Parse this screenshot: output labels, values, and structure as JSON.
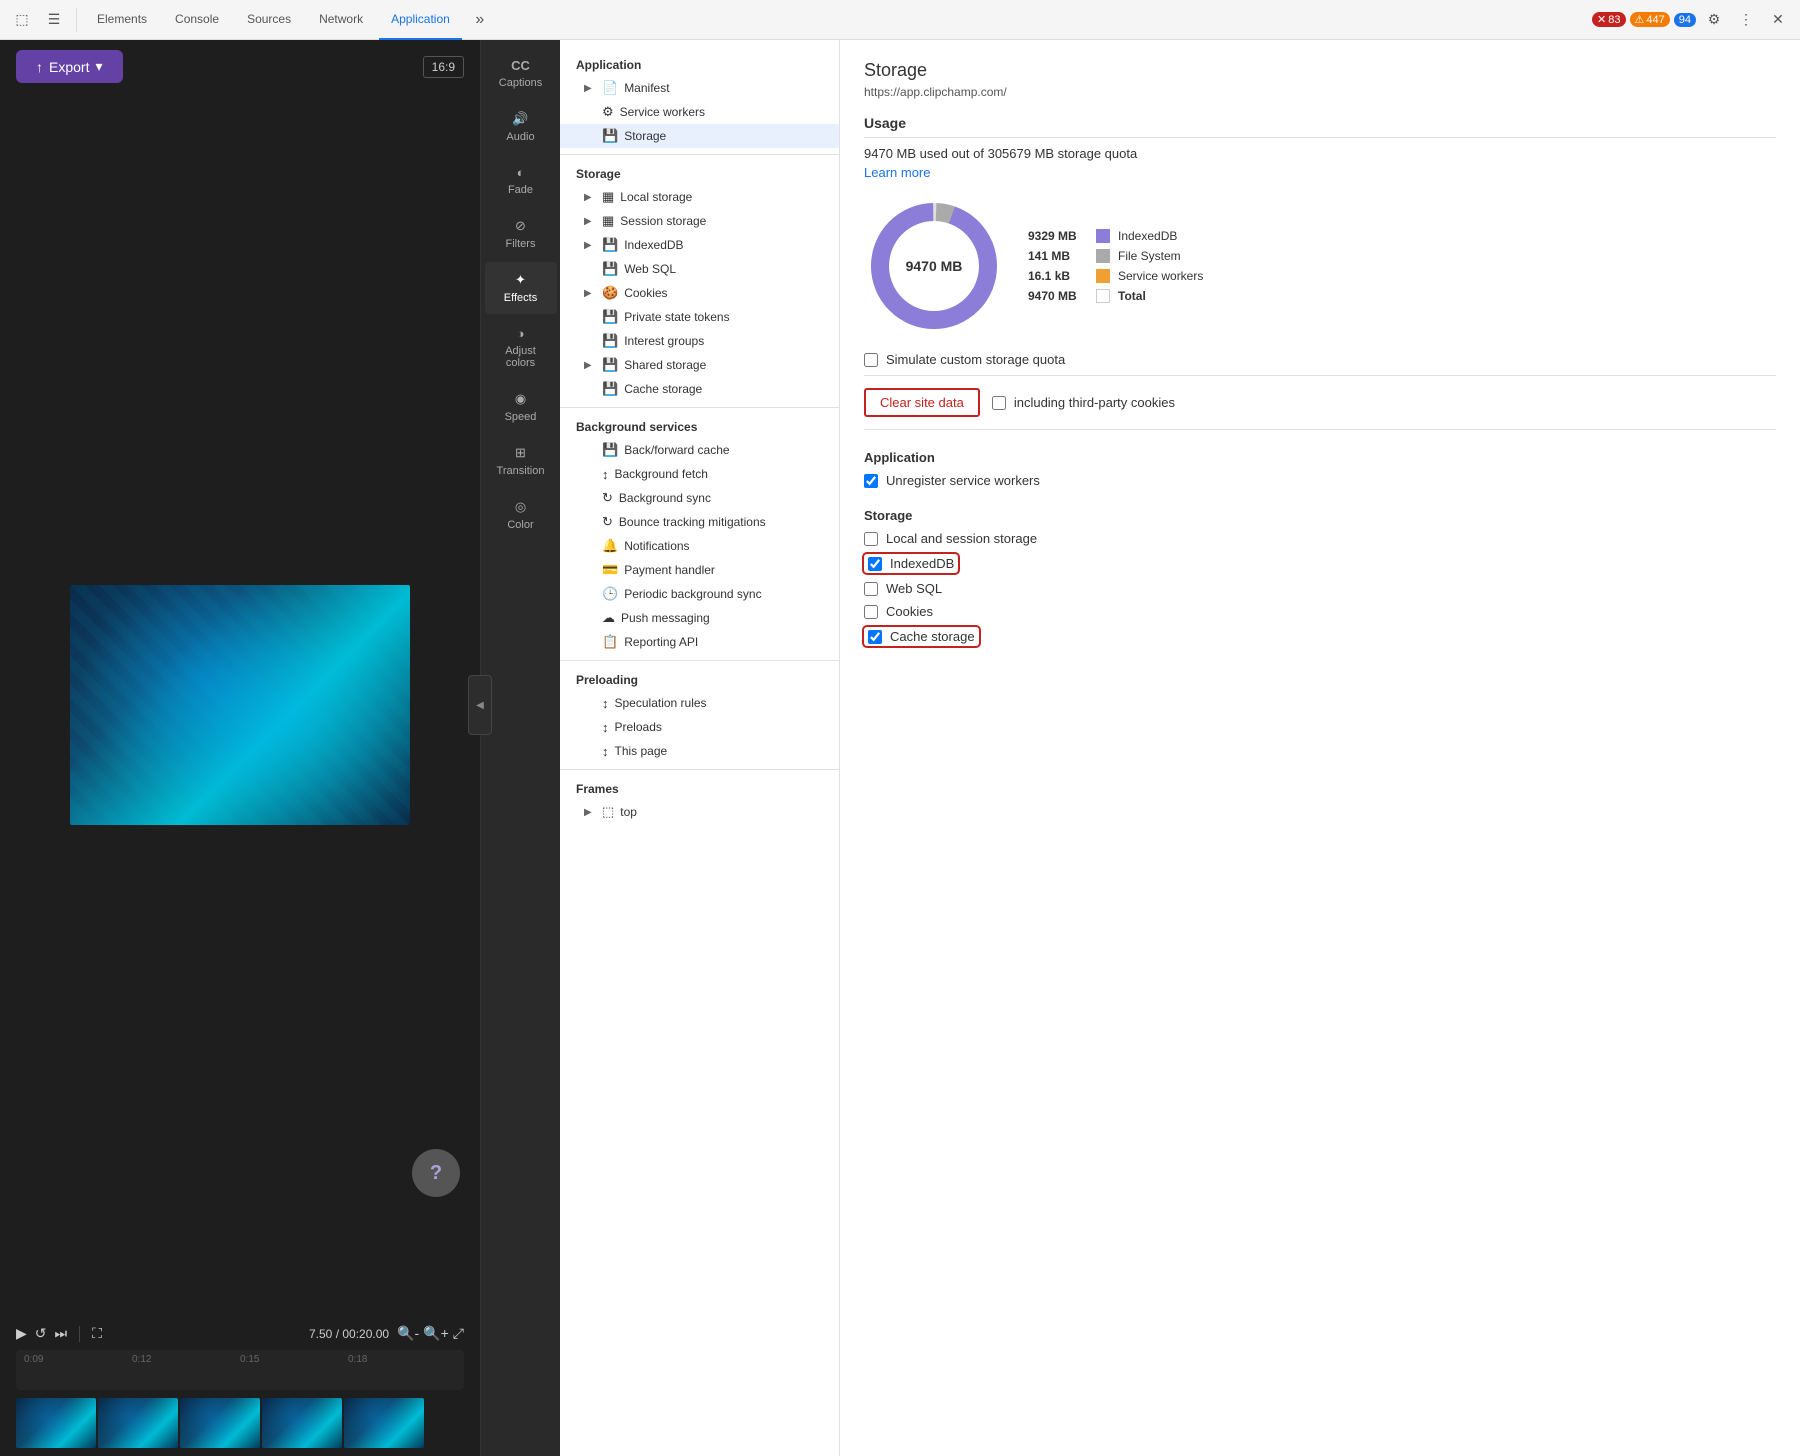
{
  "toolbar": {
    "tabs": [
      "Elements",
      "Console",
      "Sources",
      "Network",
      "Application"
    ],
    "active_tab": "Application",
    "error_count": "83",
    "warn_count": "447",
    "info_count": "94",
    "more_tabs_icon": "⋯",
    "settings_icon": "⚙",
    "more_options_icon": "⋮",
    "close_icon": "✕",
    "devtools_icon1": "☰",
    "devtools_icon2": "⬚"
  },
  "editor": {
    "export_label": "Export",
    "aspect_ratio": "16:9",
    "time_current": "7.50",
    "time_total": "00:20.00",
    "timeline_marks": [
      "0:09",
      "0:12",
      "0:15",
      "0:18"
    ],
    "sidebar_items": [
      {
        "id": "captions",
        "label": "Captions",
        "icon": "CC"
      },
      {
        "id": "audio",
        "label": "Audio",
        "icon": "🔊"
      },
      {
        "id": "fade",
        "label": "Fade",
        "icon": "◐"
      },
      {
        "id": "filters",
        "label": "Filters",
        "icon": "⊘"
      },
      {
        "id": "effects",
        "label": "Effects",
        "icon": "✦"
      },
      {
        "id": "adjust",
        "label": "Adjust colors",
        "icon": "◑"
      },
      {
        "id": "speed",
        "label": "Speed",
        "icon": "◉"
      },
      {
        "id": "transition",
        "label": "Transition",
        "icon": "⊞"
      },
      {
        "id": "color",
        "label": "Color",
        "icon": "◎"
      }
    ]
  },
  "devtools_sidebar": {
    "application_section": "Application",
    "application_items": [
      {
        "id": "manifest",
        "label": "Manifest",
        "icon": "📄",
        "expandable": true
      },
      {
        "id": "service-workers",
        "label": "Service workers",
        "icon": "⚙",
        "expandable": false
      },
      {
        "id": "storage",
        "label": "Storage",
        "icon": "💾",
        "expandable": false,
        "active": true
      }
    ],
    "storage_section": "Storage",
    "storage_items": [
      {
        "id": "local-storage",
        "label": "Local storage",
        "icon": "▦",
        "expandable": true
      },
      {
        "id": "session-storage",
        "label": "Session storage",
        "icon": "▦",
        "expandable": true
      },
      {
        "id": "indexeddb",
        "label": "IndexedDB",
        "icon": "💾",
        "expandable": true
      },
      {
        "id": "web-sql",
        "label": "Web SQL",
        "icon": "💾",
        "expandable": false
      },
      {
        "id": "cookies",
        "label": "Cookies",
        "icon": "🍪",
        "expandable": true
      },
      {
        "id": "private-state-tokens",
        "label": "Private state tokens",
        "icon": "💾",
        "expandable": false
      },
      {
        "id": "interest-groups",
        "label": "Interest groups",
        "icon": "💾",
        "expandable": false
      },
      {
        "id": "shared-storage",
        "label": "Shared storage",
        "icon": "💾",
        "expandable": true
      },
      {
        "id": "cache-storage",
        "label": "Cache storage",
        "icon": "💾",
        "expandable": false
      }
    ],
    "background_section": "Background services",
    "background_items": [
      {
        "id": "back-forward-cache",
        "label": "Back/forward cache",
        "icon": "💾"
      },
      {
        "id": "background-fetch",
        "label": "Background fetch",
        "icon": "↕"
      },
      {
        "id": "background-sync",
        "label": "Background sync",
        "icon": "↻"
      },
      {
        "id": "bounce-tracking",
        "label": "Bounce tracking mitigations",
        "icon": "↻"
      },
      {
        "id": "notifications",
        "label": "Notifications",
        "icon": "🔔"
      },
      {
        "id": "payment-handler",
        "label": "Payment handler",
        "icon": "💳"
      },
      {
        "id": "periodic-bg-sync",
        "label": "Periodic background sync",
        "icon": "🕒"
      },
      {
        "id": "push-messaging",
        "label": "Push messaging",
        "icon": "☁"
      },
      {
        "id": "reporting-api",
        "label": "Reporting API",
        "icon": "📋"
      }
    ],
    "preloading_section": "Preloading",
    "preloading_items": [
      {
        "id": "speculation-rules",
        "label": "Speculation rules",
        "icon": "↕"
      },
      {
        "id": "preloads",
        "label": "Preloads",
        "icon": "↕"
      },
      {
        "id": "this-page",
        "label": "This page",
        "icon": "↕"
      }
    ],
    "frames_section": "Frames",
    "frames_items": [
      {
        "id": "top",
        "label": "top",
        "icon": "⬚",
        "expandable": true
      }
    ]
  },
  "storage_panel": {
    "title": "Storage",
    "url": "https://app.clipchamp.com/",
    "usage_section": "Usage",
    "usage_text": "9470 MB used out of 305679 MB storage quota",
    "learn_more": "Learn more",
    "chart": {
      "center_label": "9470 MB",
      "indexed_db_value": "9329 MB",
      "indexed_db_label": "IndexedDB",
      "indexed_db_color": "#7b68ee",
      "file_system_value": "141 MB",
      "file_system_label": "File System",
      "file_system_color": "#aaaaaa",
      "service_workers_value": "16.1 kB",
      "service_workers_label": "Service workers",
      "service_workers_color": "#f0a030",
      "total_value": "9470 MB",
      "total_label": "Total"
    },
    "simulate_quota_label": "Simulate custom storage quota",
    "clear_btn_label": "Clear site data",
    "third_party_cookies_label": "including third-party cookies",
    "application_section": "Application",
    "unregister_sw_label": "Unregister service workers",
    "storage_section": "Storage",
    "local_session_label": "Local and session storage",
    "indexeddb_label": "IndexedDB",
    "web_sql_label": "Web SQL",
    "cookies_label": "Cookies",
    "cache_storage_label": "Cache storage",
    "checkboxes": {
      "simulate_quota": false,
      "third_party_cookies": false,
      "unregister_sw": true,
      "local_session": false,
      "indexeddb": true,
      "web_sql": false,
      "cookies": false,
      "cache_storage": true
    }
  }
}
